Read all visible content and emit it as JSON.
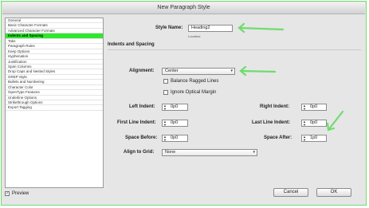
{
  "window": {
    "title": "New Paragraph Style"
  },
  "sidebar": {
    "items": [
      {
        "label": "General",
        "selected": false
      },
      {
        "label": "Basic Character Formats",
        "selected": false
      },
      {
        "label": "Advanced Character Formats",
        "selected": false
      },
      {
        "label": "Indents and Spacing",
        "selected": true
      },
      {
        "label": "Tabs",
        "selected": false
      },
      {
        "label": "Paragraph Rules",
        "selected": false
      },
      {
        "label": "Keep Options",
        "selected": false
      },
      {
        "label": "Hyphenation",
        "selected": false
      },
      {
        "label": "Justification",
        "selected": false
      },
      {
        "label": "Span Columns",
        "selected": false
      },
      {
        "label": "Drop Caps and Nested Styles",
        "selected": false
      },
      {
        "label": "GREP Style",
        "selected": false
      },
      {
        "label": "Bullets and Numbering",
        "selected": false
      },
      {
        "label": "Character Color",
        "selected": false
      },
      {
        "label": "OpenType Features",
        "selected": false
      },
      {
        "label": "Underline Options",
        "selected": false
      },
      {
        "label": "Strikethrough Options",
        "selected": false
      },
      {
        "label": "Export Tagging",
        "selected": false
      }
    ]
  },
  "preview": {
    "label": "Preview",
    "checked": true
  },
  "main": {
    "style_name_label": "Style Name:",
    "style_name_value": "Heading2",
    "location_label": "Location:",
    "section_title": "Indents and Spacing",
    "alignment_label": "Alignment:",
    "alignment_value": "Center",
    "balance_label": "Balance Ragged Lines",
    "ignore_margin_label": "Ignore Optical Margin",
    "left_indent_label": "Left Indent:",
    "left_indent_value": "0p0",
    "right_indent_label": "Right Indent:",
    "right_indent_value": "0p0",
    "first_line_label": "First Line Indent:",
    "first_line_value": "0p0",
    "last_line_label": "Last Line Indent:",
    "last_line_value": "0p0",
    "space_before_label": "Space Before:",
    "space_before_value": "0p0",
    "space_after_label": "Space After:",
    "space_after_value": "1p0",
    "align_grid_label": "Align to Grid:",
    "align_grid_value": "None"
  },
  "buttons": {
    "cancel": "Cancel",
    "ok": "OK"
  },
  "colors": {
    "highlight": "#2ee82e",
    "annotation": "#6fdc6f",
    "border": "#6fdc6f"
  },
  "icons": {
    "annotation": "green-arrow-icon",
    "dropdown": "chevron-down-icon",
    "stepper": "up-down-stepper-icon"
  }
}
